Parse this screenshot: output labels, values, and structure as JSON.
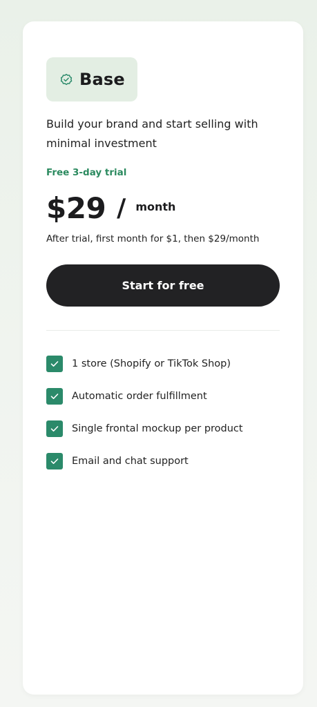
{
  "plan": {
    "icon": "verified-badge-icon",
    "name": "Base",
    "description": "Build your brand and start selling with minimal investment",
    "trial_label": "Free 3-day trial",
    "price": "$29",
    "price_separator": "/",
    "price_period": "month",
    "after_trial_note": "After trial, first month for $1, then $29/month",
    "cta_label": "Start for free"
  },
  "features": [
    {
      "icon": "check-icon",
      "text": "1 store (Shopify or TikTok Shop)"
    },
    {
      "icon": "check-icon",
      "text": "Automatic order fulfillment"
    },
    {
      "icon": "check-icon",
      "text": "Single frontal mockup per product"
    },
    {
      "icon": "check-icon",
      "text": "Email and chat support"
    }
  ],
  "colors": {
    "accent_green": "#2b8a6a",
    "trial_green": "#2b8a5f",
    "badge_bg": "#e3eee3",
    "button_bg": "#222224",
    "button_text": "#ffffff"
  }
}
